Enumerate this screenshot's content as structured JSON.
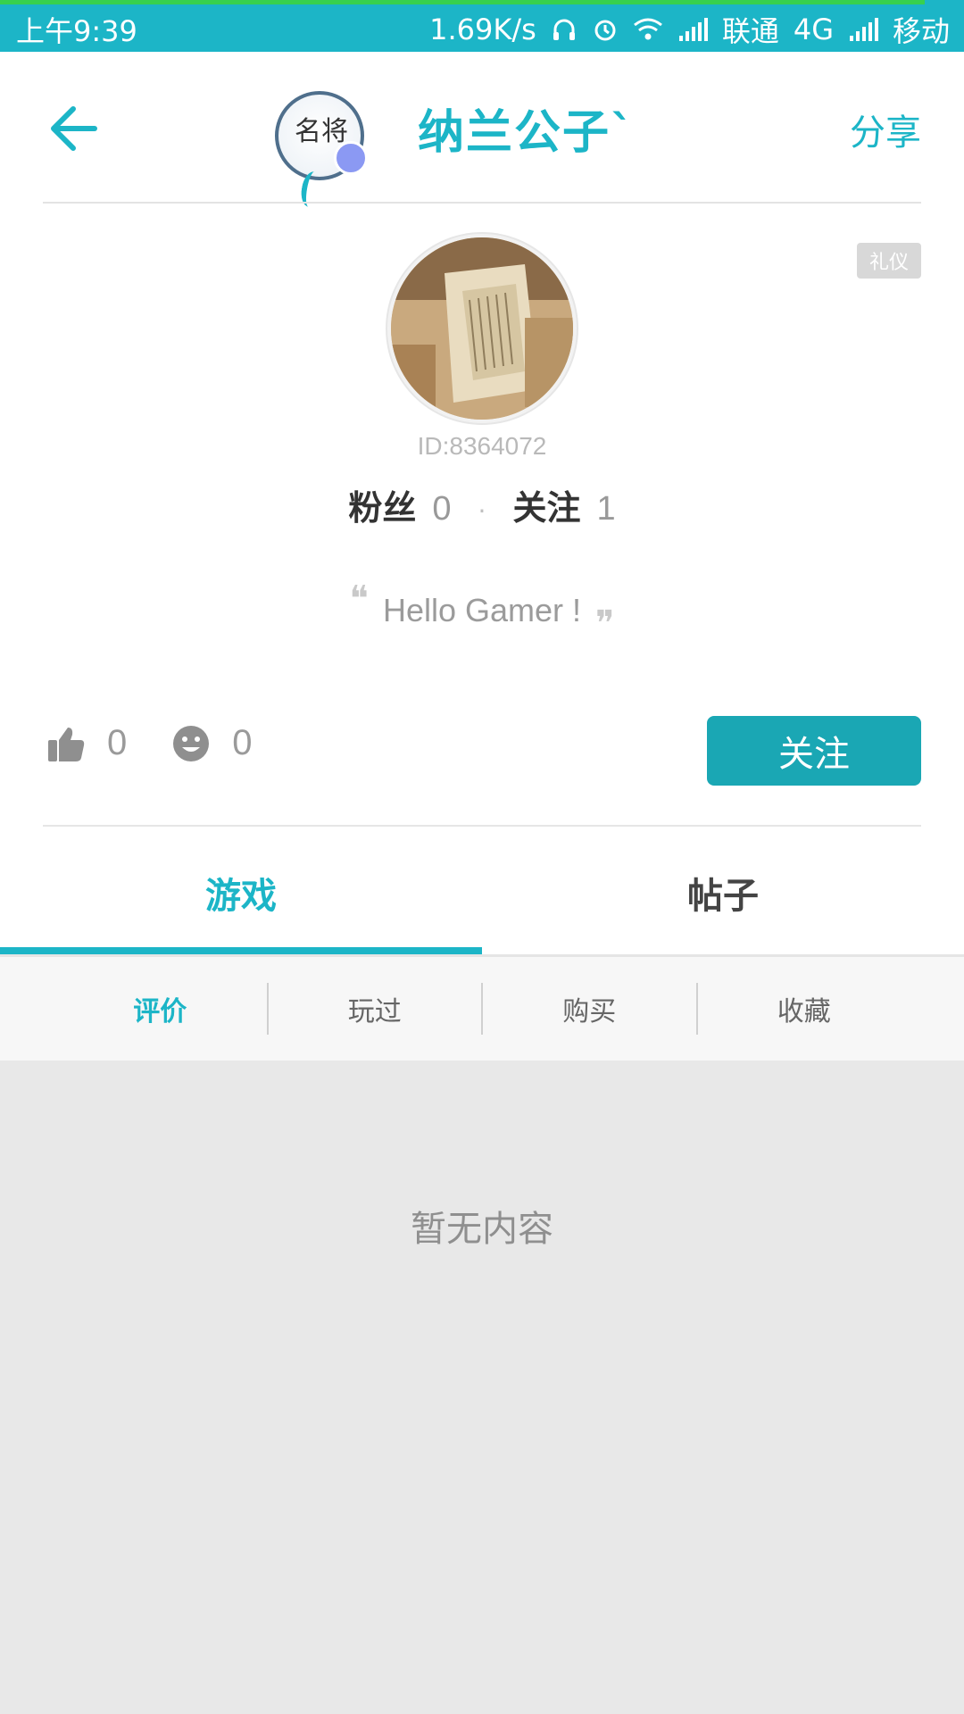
{
  "status_bar": {
    "time": "上午9:39",
    "speed": "1.69K/s",
    "carrier1": "联通",
    "network": "4G",
    "carrier2": "移动"
  },
  "header": {
    "title": "纳兰公子`",
    "share_label": "分享",
    "back_icon": "arrow-left-icon",
    "medal_text": "名将"
  },
  "profile": {
    "tag": "礼仪",
    "id_text": "ID:8364072",
    "fans_label": "粉丝",
    "fans_count": "0",
    "following_label": "关注",
    "following_count": "1",
    "signature": "Hello Gamer !",
    "likes_count": "0",
    "smile_count": "0",
    "follow_button": "关注"
  },
  "tabs": [
    {
      "label": "游戏",
      "active": true
    },
    {
      "label": "帖子",
      "active": false
    }
  ],
  "subtabs": [
    {
      "label": "评价",
      "active": true
    },
    {
      "label": "玩过",
      "active": false
    },
    {
      "label": "购买",
      "active": false
    },
    {
      "label": "收藏",
      "active": false
    }
  ],
  "content": {
    "empty_text": "暂无内容"
  },
  "colors": {
    "accent": "#1cb5c7",
    "button": "#1aa7b4",
    "background_empty": "#e8e8e8"
  }
}
